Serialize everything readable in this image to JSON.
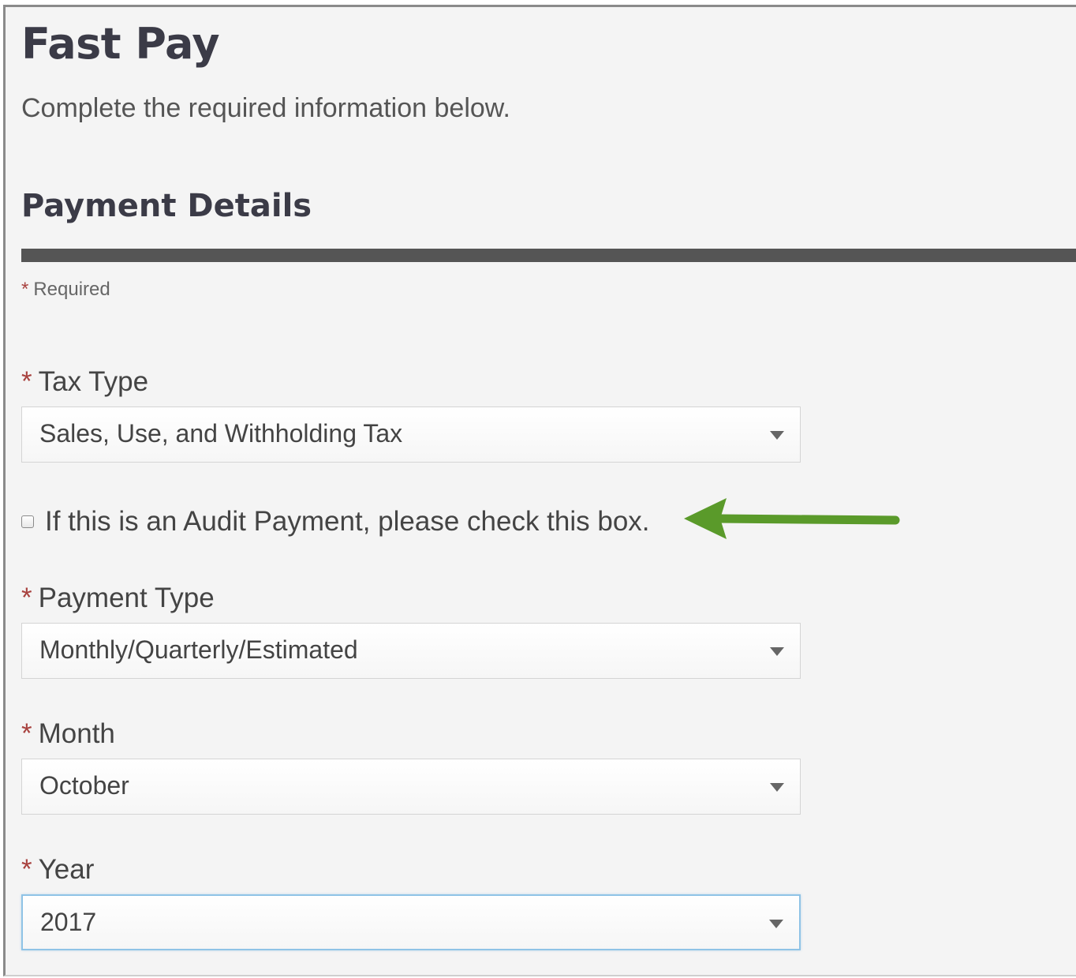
{
  "page": {
    "title": "Fast Pay",
    "subtitle": "Complete the required information below."
  },
  "section": {
    "heading": "Payment Details",
    "required_note": "Required"
  },
  "required_marker": "*",
  "form": {
    "tax_type": {
      "label": "Tax Type",
      "value": "Sales, Use, and Withholding Tax"
    },
    "audit_checkbox": {
      "label": "If this is an Audit Payment, please check this box.",
      "checked": false
    },
    "payment_type": {
      "label": "Payment Type",
      "value": "Monthly/Quarterly/Estimated"
    },
    "month": {
      "label": "Month",
      "value": "October"
    },
    "year": {
      "label": "Year",
      "value": "2017",
      "focused": true
    }
  },
  "icons": {
    "dropdown": "caret-down-icon",
    "annotation": "arrow-left-icon"
  },
  "colors": {
    "required_star": "#a8423f",
    "annotation_arrow": "#5a9a2a",
    "focus_border": "#8fc3e6",
    "divider": "#555555"
  }
}
